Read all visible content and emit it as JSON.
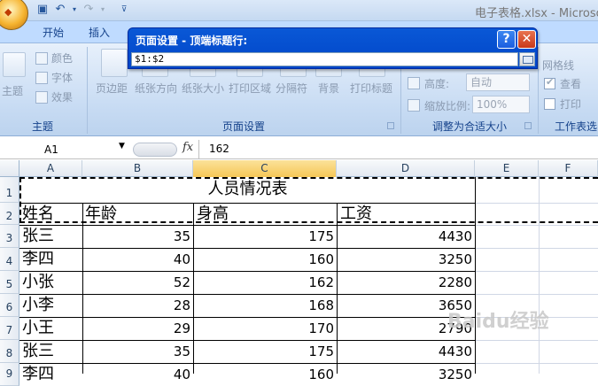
{
  "window": {
    "title": "电子表格.xlsx - Microso"
  },
  "qat": {
    "save_icon": "save-icon",
    "undo_icon": "undo-icon",
    "redo_icon": "redo-icon",
    "customize_icon": "customize-icon"
  },
  "tabs": [
    "开始",
    "插入"
  ],
  "ribbon": {
    "theme_group": {
      "label": "主题",
      "themes": "主题",
      "colors": "颜色",
      "fonts": "字体",
      "effects": "效果"
    },
    "page_setup_group": {
      "label": "页面设置",
      "buttons": [
        "页边距",
        "纸张方向",
        "纸张大小",
        "打印区域",
        "分隔符",
        "背景",
        "打印标题"
      ]
    },
    "scale_group": {
      "label": "调整为合适大小",
      "height_label": "高度:",
      "height_value": "自动",
      "scale_label": "缩放比例:",
      "scale_value": "100%"
    },
    "sheet_options_group": {
      "label": "工作表选",
      "gridlines": "网格线",
      "view": "查看",
      "print": "打印"
    }
  },
  "formula_bar": {
    "name_box": "A1",
    "fx": "fx",
    "value": "162"
  },
  "columns": [
    "A",
    "B",
    "C",
    "D",
    "E",
    "F"
  ],
  "rows": [
    "1",
    "2",
    "3",
    "4",
    "5",
    "6",
    "7",
    "8",
    "9"
  ],
  "sheet": {
    "title": "人员情况表",
    "headers": [
      "姓名",
      "年龄",
      "身高",
      "工资"
    ],
    "data": [
      [
        "张三",
        "35",
        "175",
        "4430"
      ],
      [
        "李四",
        "40",
        "160",
        "3250"
      ],
      [
        "小张",
        "52",
        "162",
        "2280"
      ],
      [
        "小李",
        "28",
        "168",
        "3650"
      ],
      [
        "小王",
        "29",
        "170",
        "2790"
      ],
      [
        "张三",
        "35",
        "175",
        "4430"
      ],
      [
        "李四",
        "40",
        "160",
        "3250"
      ]
    ]
  },
  "dialog": {
    "title": "页面设置 - 顶端标题行:",
    "input_value": "$1:$2",
    "help": "?",
    "close": "✕"
  },
  "watermark": "Baidu经验"
}
